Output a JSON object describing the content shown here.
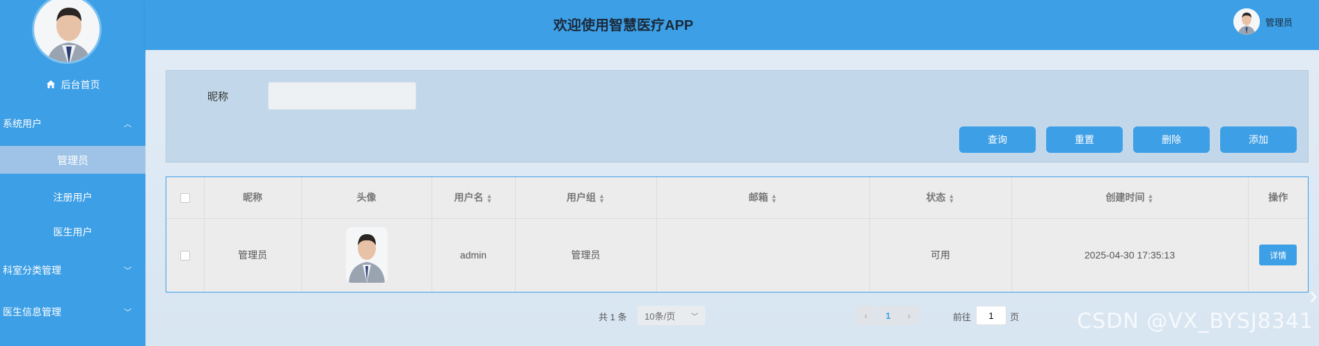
{
  "header": {
    "title": "欢迎使用智慧医疗APP",
    "user_label": "管理员"
  },
  "sidebar": {
    "home_label": "后台首页",
    "groups": [
      {
        "label": "系统用户",
        "expanded": true
      },
      {
        "label": "科室分类管理",
        "expanded": false
      },
      {
        "label": "医生信息管理",
        "expanded": false
      }
    ],
    "items": [
      {
        "label": "管理员",
        "active": true
      },
      {
        "label": "注册用户",
        "active": false
      },
      {
        "label": "医生用户",
        "active": false
      }
    ]
  },
  "search": {
    "label": "昵称",
    "value": "",
    "placeholder": "",
    "buttons": {
      "query": "查询",
      "reset": "重置",
      "delete": "删除",
      "add": "添加"
    }
  },
  "table": {
    "columns": {
      "nickname": "昵称",
      "avatar": "头像",
      "username": "用户名",
      "group": "用户组",
      "email": "邮箱",
      "status": "状态",
      "created": "创建时间",
      "actions": "操作"
    },
    "rows": [
      {
        "nickname": "管理员",
        "username": "admin",
        "group": "管理员",
        "email": "",
        "status": "可用",
        "created": "2025-04-30 17:35:13",
        "action_label": "详情"
      }
    ]
  },
  "pagination": {
    "total_label": "共 1 条",
    "page_size": "10条/页",
    "current_page": "1",
    "goto_label": "前往",
    "goto_value": "1",
    "page_suffix": "页"
  },
  "watermark": "CSDN @VX_BYSJ8341",
  "colors": {
    "primary": "#3d9fe6",
    "sidebar_active": "#9fc3e6",
    "panel": "#c2d8ea"
  }
}
